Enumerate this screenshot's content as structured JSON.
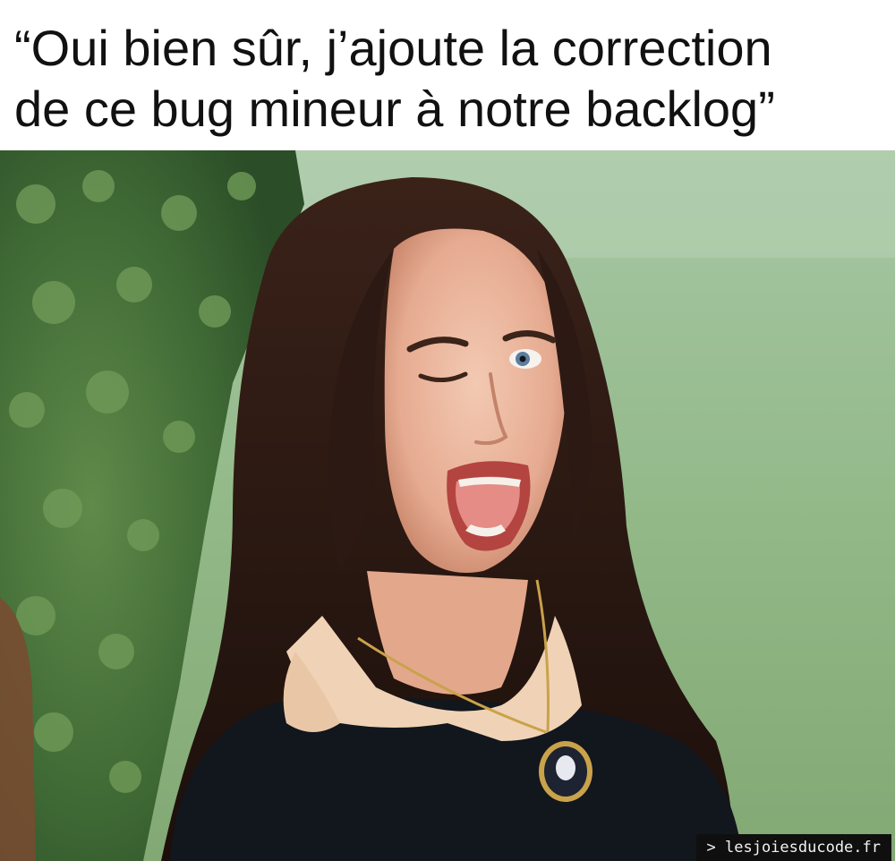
{
  "caption": {
    "line1": "“Oui bien sûr, j’ajoute la correction",
    "line2": "de ce bug mineur à notre backlog”"
  },
  "photo": {
    "description_icon": "winking-woman-photo"
  },
  "watermark": {
    "text": "> lesjoiesducode.fr"
  },
  "colors": {
    "background": "#ffffff",
    "caption_text": "#111111",
    "watermark_bg": "#0f0f0f",
    "watermark_text": "#f2f2f2"
  }
}
